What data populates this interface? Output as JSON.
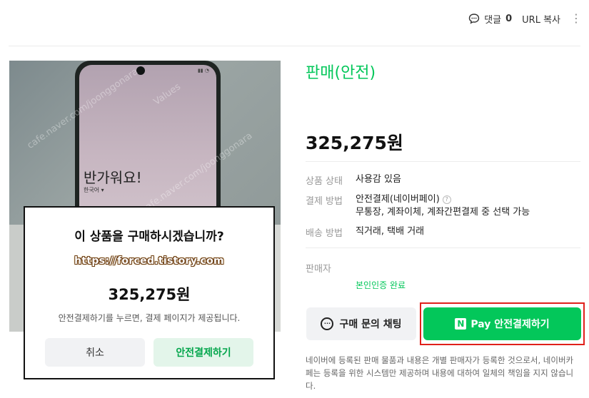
{
  "topbar": {
    "comment_label": "댓글",
    "comment_count": "0",
    "url_copy_label": "URL 복사",
    "more_icon": "more-vertical-icon",
    "comment_icon": "speech-bubble-icon"
  },
  "product": {
    "photo_screen_text": "반가워요!",
    "photo_lang_text": "한국어 ▾",
    "sale_type": "판매(안전)",
    "price": "325,275원",
    "details": [
      {
        "label": "상품 상태",
        "value": "사용감 있음"
      },
      {
        "label": "결제 방법",
        "value": "안전결제(네이버페이)",
        "value2": "무통장, 계좌이체, 계좌간편결제 중 선택 가능"
      },
      {
        "label": "배송 방법",
        "value": "직거래, 택배 거래"
      }
    ],
    "seller_label": "판매자",
    "verified_label": "본인인증 완료"
  },
  "actions": {
    "chat_label": "구매 문의 채팅",
    "pay_logo": "N",
    "pay_label": "Pay 안전결제하기"
  },
  "notice": "네이버에 등록된 판매 물품과 내용은 개별 판매자가 등록한 것으로서, 네이버카페는 등록을 위한 시스템만 제공하며 내용에 대하여 일체의 책임을 지지 않습니다.",
  "dialog": {
    "question": "이 상품을 구매하시겠습니까?",
    "url_text": "https://forced.tistory.com",
    "price": "325,275원",
    "info": "안전결제하기를 누르면, 결제 페이지가 제공됩니다.",
    "cancel_label": "취소",
    "confirm_label": "안전결제하기"
  },
  "colors": {
    "brand_green": "#03c75a",
    "highlight_red": "#e0201b"
  }
}
